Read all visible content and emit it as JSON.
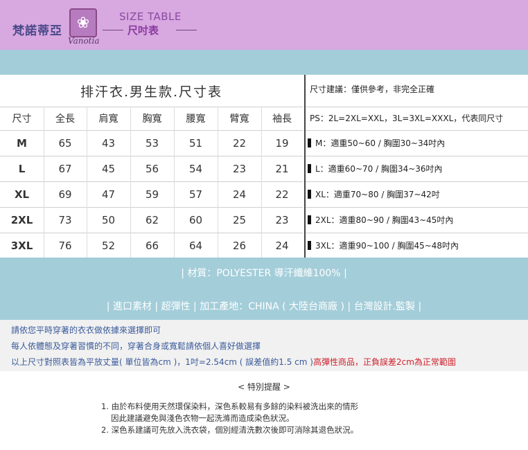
{
  "header": {
    "brand_cn": "梵諾蒂亞",
    "brand_en": "Vanotia",
    "size_title_en": "SIZE TABLE",
    "size_title_cn": "尺吋表",
    "logo_icon": "flower-emblem-icon",
    "colors": {
      "header_bg": "#d8a8e0",
      "band_bg": "#a3cdd9",
      "accent": "#8a3aa0"
    }
  },
  "table": {
    "title": "排汗衣.男生款.尺寸表",
    "columns": [
      "尺寸",
      "全長",
      "肩寬",
      "胸寬",
      "腰寬",
      "臂寬",
      "袖長"
    ],
    "rows": [
      [
        "M",
        "65",
        "43",
        "53",
        "51",
        "22",
        "19"
      ],
      [
        "L",
        "67",
        "45",
        "56",
        "54",
        "23",
        "21"
      ],
      [
        "XL",
        "69",
        "47",
        "59",
        "57",
        "24",
        "22"
      ],
      [
        "2XL",
        "73",
        "50",
        "62",
        "60",
        "25",
        "23"
      ],
      [
        "3XL",
        "76",
        "52",
        "66",
        "64",
        "26",
        "24"
      ]
    ]
  },
  "size_notes": {
    "heading": "尺寸建議：僅供參考，非完全正確",
    "ps": "PS：2L=2XL=XXL，3L=3XL=XXXL，代表同尺寸",
    "fits": [
      "M：適重50~60  /  胸圍30~34吋內",
      "L：適重60~70  /  胸圍34~36吋內",
      "XL：適重70~80  /  胸圍37~42吋",
      "2XL：適重80~90  /  胸圍43~45吋內",
      "3XL：適重90~100  /  胸圍45~48吋內"
    ]
  },
  "material": "|  材質：POLYESTER 導汗纖維100%  |",
  "features": "|  進口素材  |  超彈性  |  加工產地：CHINA ( 大陸台商廠 )  |  台灣設計.監製  |",
  "notes": {
    "line1": "請依您平時穿著的衣衣做依據來選擇即可",
    "line2": "每人依體態及穿著習慣的不同，穿著合身或寬鬆請依個人喜好做選擇",
    "line3_blue": "以上尺寸對照表皆為平放丈量( 單位皆為cm )，1吋=2.54cm ( 誤差值約1.5 cm )",
    "line3_red": "高彈性商品，正負誤差2cm為正常範圍"
  },
  "reminder": {
    "title": "< 特別提醒 >",
    "item1_a": "1. 由於布料使用天然環保染料，深色系較易有多餘的染料被洗出來的情形",
    "item1_b": "因此建議避免與淺色衣物一起洗滌而造成染色狀況。",
    "item2": "2. 深色系建議可先放入洗衣袋，個別經清洗數次後即可消除其退色狀況。"
  }
}
